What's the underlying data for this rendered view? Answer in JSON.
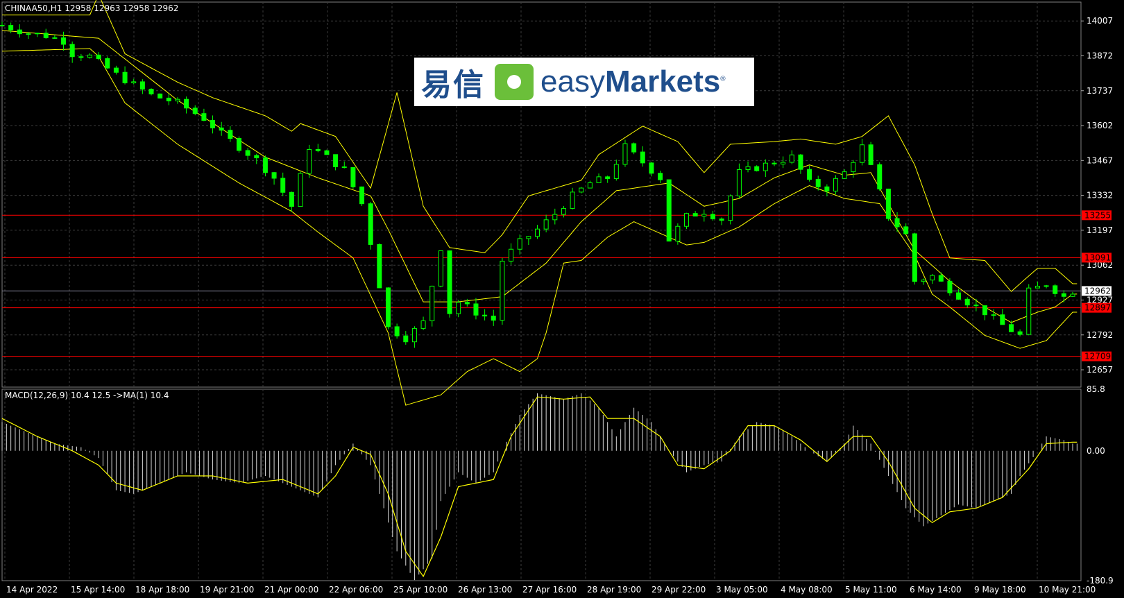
{
  "chart_data": [
    {
      "type": "candlestick",
      "title": "CHINAA50,H1  12958 12963 12958 12962",
      "indicators": [
        "Bollinger Bands"
      ],
      "ylim": [
        12590,
        14080
      ],
      "y_ticks": [
        14007,
        13872,
        13737,
        13602,
        13467,
        13332,
        13197,
        13062,
        12927,
        12792,
        12657
      ],
      "current_price": 12962,
      "levels": [
        {
          "value": 13255,
          "label": "13255",
          "color": "#ff0000"
        },
        {
          "value": 13091,
          "label": "13091",
          "color": "#ff0000"
        },
        {
          "value": 12897,
          "label": "12897",
          "color": "#ff0000"
        },
        {
          "value": 12709,
          "label": "12709",
          "color": "#ff0000"
        }
      ],
      "x_labels": [
        "14 Apr 2022",
        "15 Apr 14:00",
        "18 Apr 18:00",
        "19 Apr 21:00",
        "21 Apr 00:00",
        "22 Apr 06:00",
        "25 Apr 10:00",
        "26 Apr 13:00",
        "27 Apr 16:00",
        "28 Apr 19:00",
        "29 Apr 22:00",
        "3 May 05:00",
        "4 May 08:00",
        "5 May 11:00",
        "6 May 14:00",
        "9 May 18:00",
        "10 May 21:00"
      ],
      "close_path": [
        [
          0,
          13990
        ],
        [
          3,
          13960
        ],
        [
          5,
          13950
        ],
        [
          7,
          13930
        ],
        [
          8,
          13880
        ],
        [
          10,
          13870
        ],
        [
          13,
          13800
        ],
        [
          15,
          13760
        ],
        [
          17,
          13720
        ],
        [
          20,
          13690
        ],
        [
          23,
          13630
        ],
        [
          25,
          13570
        ],
        [
          27,
          13520
        ],
        [
          29,
          13470
        ],
        [
          31,
          13400
        ],
        [
          33,
          13290
        ],
        [
          35,
          13520
        ],
        [
          37,
          13480
        ],
        [
          39,
          13430
        ],
        [
          41,
          13300
        ],
        [
          42,
          13150
        ],
        [
          44,
          12820
        ],
        [
          46,
          12780
        ],
        [
          48,
          12840
        ],
        [
          50,
          13130
        ],
        [
          51,
          12880
        ],
        [
          52,
          12920
        ],
        [
          54,
          12880
        ],
        [
          56,
          12850
        ],
        [
          57,
          13080
        ],
        [
          59,
          13150
        ],
        [
          61,
          13200
        ],
        [
          63,
          13260
        ],
        [
          65,
          13330
        ],
        [
          67,
          13380
        ],
        [
          69,
          13400
        ],
        [
          71,
          13520
        ],
        [
          73,
          13460
        ],
        [
          75,
          13400
        ],
        [
          76,
          13160
        ],
        [
          78,
          13250
        ],
        [
          80,
          13270
        ],
        [
          82,
          13240
        ],
        [
          84,
          13420
        ],
        [
          86,
          13440
        ],
        [
          88,
          13460
        ],
        [
          90,
          13480
        ],
        [
          92,
          13380
        ],
        [
          94,
          13360
        ],
        [
          96,
          13420
        ],
        [
          98,
          13520
        ],
        [
          99,
          13440
        ],
        [
          101,
          13250
        ],
        [
          103,
          13180
        ],
        [
          104,
          13000
        ],
        [
          106,
          13020
        ],
        [
          108,
          12970
        ],
        [
          110,
          12920
        ],
        [
          112,
          12880
        ],
        [
          114,
          12830
        ],
        [
          116,
          12790
        ],
        [
          117,
          12960
        ],
        [
          119,
          12990
        ],
        [
          121,
          12940
        ],
        [
          122,
          12962
        ]
      ],
      "bb_upper": [
        [
          0,
          14030
        ],
        [
          10,
          14030
        ],
        [
          11,
          14110
        ],
        [
          14,
          13880
        ],
        [
          20,
          13770
        ],
        [
          24,
          13710
        ],
        [
          30,
          13640
        ],
        [
          33,
          13580
        ],
        [
          34,
          13610
        ],
        [
          38,
          13560
        ],
        [
          42,
          13360
        ],
        [
          45,
          13730
        ],
        [
          48,
          13290
        ],
        [
          51,
          13130
        ],
        [
          55,
          13110
        ],
        [
          57,
          13180
        ],
        [
          60,
          13330
        ],
        [
          63,
          13360
        ],
        [
          66,
          13390
        ],
        [
          68,
          13490
        ],
        [
          73,
          13600
        ],
        [
          77,
          13540
        ],
        [
          80,
          13420
        ],
        [
          83,
          13530
        ],
        [
          88,
          13540
        ],
        [
          91,
          13550
        ],
        [
          95,
          13530
        ],
        [
          98,
          13560
        ],
        [
          101,
          13640
        ],
        [
          104,
          13450
        ],
        [
          106,
          13260
        ],
        [
          108,
          13090
        ],
        [
          112,
          13080
        ],
        [
          115,
          12960
        ],
        [
          118,
          13050
        ],
        [
          120,
          13050
        ],
        [
          122,
          12990
        ]
      ],
      "bb_middle": [
        [
          0,
          13970
        ],
        [
          11,
          13940
        ],
        [
          20,
          13700
        ],
        [
          30,
          13480
        ],
        [
          36,
          13400
        ],
        [
          42,
          13330
        ],
        [
          44,
          13200
        ],
        [
          48,
          12920
        ],
        [
          52,
          12920
        ],
        [
          57,
          12940
        ],
        [
          62,
          13070
        ],
        [
          66,
          13230
        ],
        [
          70,
          13350
        ],
        [
          76,
          13380
        ],
        [
          80,
          13290
        ],
        [
          84,
          13320
        ],
        [
          88,
          13400
        ],
        [
          92,
          13450
        ],
        [
          96,
          13410
        ],
        [
          99,
          13420
        ],
        [
          101,
          13300
        ],
        [
          104,
          13120
        ],
        [
          108,
          13000
        ],
        [
          112,
          12900
        ],
        [
          115,
          12840
        ],
        [
          118,
          12880
        ],
        [
          120,
          12900
        ],
        [
          122,
          12950
        ]
      ],
      "bb_lower": [
        [
          0,
          13890
        ],
        [
          10,
          13900
        ],
        [
          11,
          13870
        ],
        [
          14,
          13690
        ],
        [
          20,
          13530
        ],
        [
          27,
          13380
        ],
        [
          33,
          13270
        ],
        [
          36,
          13190
        ],
        [
          40,
          13090
        ],
        [
          44,
          12800
        ],
        [
          46,
          12520
        ],
        [
          50,
          12560
        ],
        [
          53,
          12650
        ],
        [
          56,
          12700
        ],
        [
          59,
          12650
        ],
        [
          61,
          12700
        ],
        [
          62,
          12800
        ],
        [
          64,
          13070
        ],
        [
          66,
          13080
        ],
        [
          69,
          13170
        ],
        [
          72,
          13230
        ],
        [
          76,
          13170
        ],
        [
          78,
          13140
        ],
        [
          80,
          13150
        ],
        [
          84,
          13210
        ],
        [
          88,
          13300
        ],
        [
          92,
          13370
        ],
        [
          96,
          13320
        ],
        [
          100,
          13300
        ],
        [
          104,
          13100
        ],
        [
          106,
          12950
        ],
        [
          108,
          12900
        ],
        [
          112,
          12790
        ],
        [
          116,
          12740
        ],
        [
          119,
          12770
        ],
        [
          122,
          12880
        ]
      ]
    },
    {
      "type": "histogram",
      "title": "MACD(12,26,9) 10.4 12.5  ->MA(1) 10.4",
      "ylim": [
        -180.9,
        85.8
      ],
      "y_ticks": [
        85.8,
        0.0,
        -180.9
      ],
      "macd": [
        [
          0,
          40
        ],
        [
          3,
          25
        ],
        [
          6,
          10
        ],
        [
          9,
          5
        ],
        [
          11,
          -10
        ],
        [
          13,
          -55
        ],
        [
          15,
          -60
        ],
        [
          18,
          -45
        ],
        [
          21,
          -30
        ],
        [
          24,
          -40
        ],
        [
          27,
          -45
        ],
        [
          30,
          -35
        ],
        [
          33,
          -50
        ],
        [
          36,
          -65
        ],
        [
          38,
          -20
        ],
        [
          40,
          10
        ],
        [
          42,
          -20
        ],
        [
          43,
          -60
        ],
        [
          45,
          -140
        ],
        [
          47,
          -180
        ],
        [
          49,
          -150
        ],
        [
          50,
          -70
        ],
        [
          52,
          -30
        ],
        [
          54,
          -45
        ],
        [
          56,
          -30
        ],
        [
          57,
          0
        ],
        [
          59,
          50
        ],
        [
          61,
          80
        ],
        [
          64,
          72
        ],
        [
          66,
          80
        ],
        [
          68,
          60
        ],
        [
          70,
          20
        ],
        [
          72,
          60
        ],
        [
          74,
          40
        ],
        [
          76,
          0
        ],
        [
          78,
          -30
        ],
        [
          80,
          -20
        ],
        [
          82,
          -15
        ],
        [
          84,
          20
        ],
        [
          86,
          40
        ],
        [
          88,
          35
        ],
        [
          90,
          20
        ],
        [
          92,
          0
        ],
        [
          94,
          -15
        ],
        [
          96,
          10
        ],
        [
          97,
          35
        ],
        [
          99,
          10
        ],
        [
          101,
          -35
        ],
        [
          103,
          -80
        ],
        [
          105,
          -105
        ],
        [
          107,
          -90
        ],
        [
          109,
          -75
        ],
        [
          111,
          -80
        ],
        [
          113,
          -70
        ],
        [
          115,
          -60
        ],
        [
          116,
          -35
        ],
        [
          118,
          0
        ],
        [
          119,
          20
        ],
        [
          121,
          15
        ],
        [
          122,
          10
        ]
      ],
      "signal": [
        [
          0,
          45
        ],
        [
          4,
          20
        ],
        [
          8,
          0
        ],
        [
          11,
          -20
        ],
        [
          13,
          -45
        ],
        [
          16,
          -55
        ],
        [
          20,
          -35
        ],
        [
          24,
          -35
        ],
        [
          28,
          -45
        ],
        [
          32,
          -40
        ],
        [
          36,
          -60
        ],
        [
          38,
          -35
        ],
        [
          40,
          5
        ],
        [
          42,
          -5
        ],
        [
          44,
          -60
        ],
        [
          46,
          -140
        ],
        [
          48,
          -175
        ],
        [
          50,
          -120
        ],
        [
          52,
          -50
        ],
        [
          56,
          -40
        ],
        [
          58,
          20
        ],
        [
          61,
          75
        ],
        [
          64,
          72
        ],
        [
          67,
          75
        ],
        [
          69,
          45
        ],
        [
          72,
          45
        ],
        [
          75,
          20
        ],
        [
          77,
          -20
        ],
        [
          80,
          -25
        ],
        [
          83,
          0
        ],
        [
          85,
          35
        ],
        [
          88,
          35
        ],
        [
          91,
          15
        ],
        [
          94,
          -15
        ],
        [
          97,
          20
        ],
        [
          99,
          20
        ],
        [
          101,
          -15
        ],
        [
          104,
          -80
        ],
        [
          106,
          -100
        ],
        [
          108,
          -85
        ],
        [
          111,
          -80
        ],
        [
          114,
          -65
        ],
        [
          117,
          -25
        ],
        [
          119,
          10
        ],
        [
          122,
          12
        ]
      ]
    }
  ],
  "logo": {
    "cn": "易信",
    "en_light": "easy",
    "en_bold": "Markets",
    "reg": "®"
  },
  "colors": {
    "candle": "#00ff00",
    "bands": "#ffff00",
    "level": "#ff0000",
    "grid": "#3c3c3c",
    "text": "#ffffff"
  }
}
